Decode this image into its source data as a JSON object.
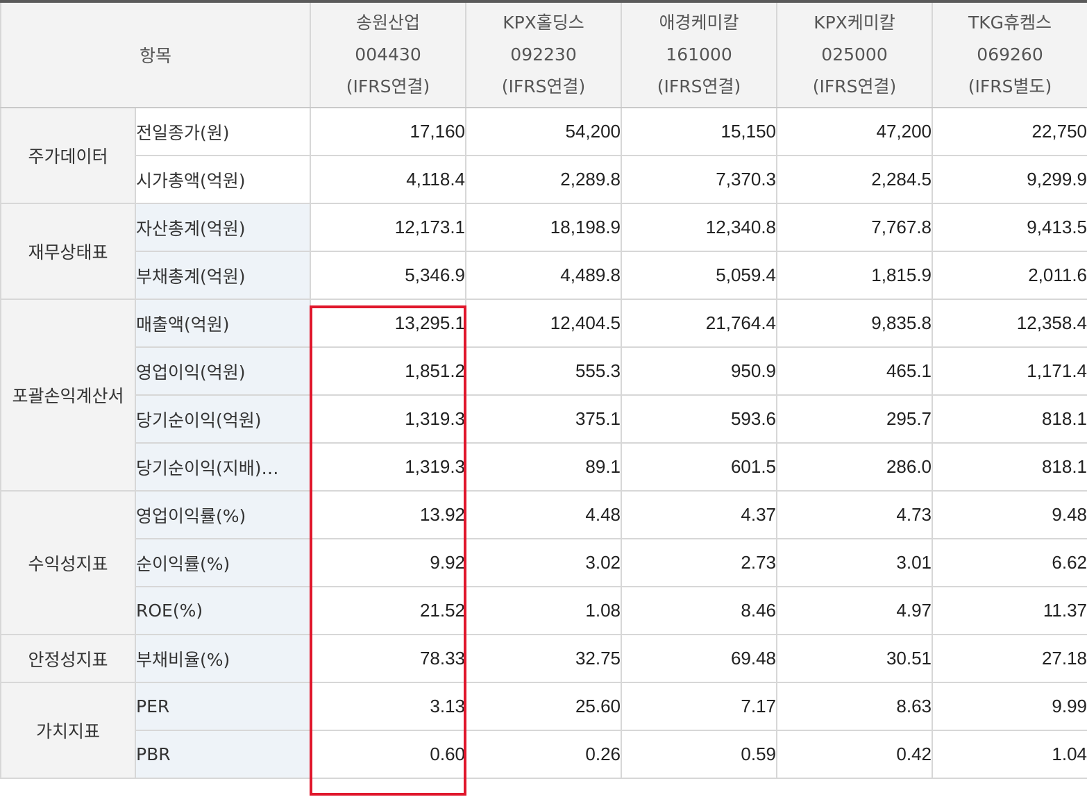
{
  "header": {
    "item_label": "항목",
    "companies": [
      {
        "name": "송원산업",
        "code": "004430",
        "basis": "(IFRS연결)"
      },
      {
        "name": "KPX홀딩스",
        "code": "092230",
        "basis": "(IFRS연결)"
      },
      {
        "name": "애경케미칼",
        "code": "161000",
        "basis": "(IFRS연결)"
      },
      {
        "name": "KPX케미칼",
        "code": "025000",
        "basis": "(IFRS연결)"
      },
      {
        "name": "TKG휴켐스",
        "code": "069260",
        "basis": "(IFRS별도)"
      }
    ]
  },
  "groups": [
    {
      "label": "주가데이터",
      "rows": [
        {
          "label": "전일종가(원)",
          "values": [
            "17,160",
            "54,200",
            "15,150",
            "47,200",
            "22,750"
          ]
        },
        {
          "label": "시가총액(억원)",
          "values": [
            "4,118.4",
            "2,289.8",
            "7,370.3",
            "2,284.5",
            "9,299.9"
          ]
        }
      ]
    },
    {
      "label": "재무상태표",
      "rows": [
        {
          "label": "자산총계(억원)",
          "values": [
            "12,173.1",
            "18,198.9",
            "12,340.8",
            "7,767.8",
            "9,413.5"
          ]
        },
        {
          "label": "부채총계(억원)",
          "values": [
            "5,346.9",
            "4,489.8",
            "5,059.4",
            "1,815.9",
            "2,011.6"
          ]
        }
      ]
    },
    {
      "label": "포괄손익계산서",
      "rows": [
        {
          "label": "매출액(억원)",
          "values": [
            "13,295.1",
            "12,404.5",
            "21,764.4",
            "9,835.8",
            "12,358.4"
          ]
        },
        {
          "label": "영업이익(억원)",
          "values": [
            "1,851.2",
            "555.3",
            "950.9",
            "465.1",
            "1,171.4"
          ]
        },
        {
          "label": "당기순이익(억원)",
          "values": [
            "1,319.3",
            "375.1",
            "593.6",
            "295.7",
            "818.1"
          ]
        },
        {
          "label": "당기순이익(지배)…",
          "values": [
            "1,319.3",
            "89.1",
            "601.5",
            "286.0",
            "818.1"
          ]
        }
      ]
    },
    {
      "label": "수익성지표",
      "rows": [
        {
          "label": "영업이익률(%)",
          "values": [
            "13.92",
            "4.48",
            "4.37",
            "4.73",
            "9.48"
          ]
        },
        {
          "label": "순이익률(%)",
          "values": [
            "9.92",
            "3.02",
            "2.73",
            "3.01",
            "6.62"
          ]
        },
        {
          "label": "ROE(%)",
          "values": [
            "21.52",
            "1.08",
            "8.46",
            "4.97",
            "11.37"
          ]
        }
      ]
    },
    {
      "label": "안정성지표",
      "rows": [
        {
          "label": "부채비율(%)",
          "values": [
            "78.33",
            "32.75",
            "69.48",
            "30.51",
            "27.18"
          ]
        }
      ]
    },
    {
      "label": "가치지표",
      "rows": [
        {
          "label": "PER",
          "values": [
            "3.13",
            "25.60",
            "7.17",
            "8.63",
            "9.99"
          ]
        },
        {
          "label": "PBR",
          "values": [
            "0.60",
            "0.26",
            "0.59",
            "0.42",
            "1.04"
          ]
        }
      ]
    }
  ],
  "colors": {
    "highlight_border": "#e0172c",
    "header_bg": "#f3f3f3",
    "item_blue_bg": "#eef3f8",
    "grid_line": "#d7d7d7"
  }
}
